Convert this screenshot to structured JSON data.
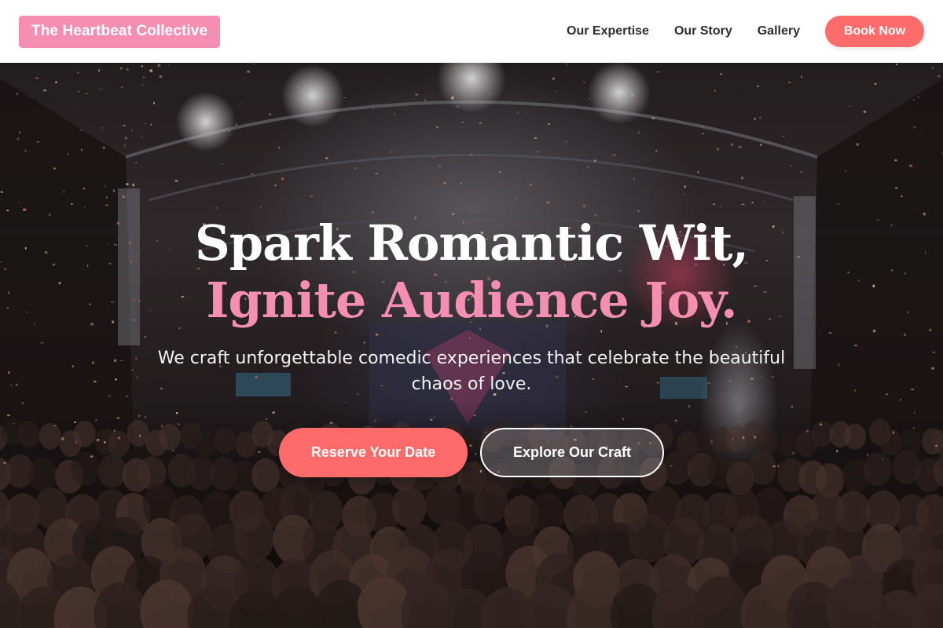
{
  "header": {
    "brand": "The Heartbeat Collective",
    "nav": [
      {
        "label": "Our Expertise"
      },
      {
        "label": "Our Story"
      },
      {
        "label": "Gallery"
      }
    ],
    "cta_label": "Book Now"
  },
  "hero": {
    "headline_line1": "Spark Romantic Wit,",
    "headline_line2": "Ignite Audience Joy.",
    "subtitle": "We craft unforgettable comedic experiences that celebrate the beautiful chaos of love.",
    "primary_button": "Reserve Your Date",
    "secondary_button": "Explore Our Craft",
    "background_image": "concert-crowd-confetti-photo"
  },
  "colors": {
    "accent_pink": "#f48fb1",
    "accent_coral": "#ff6b6b",
    "header_bg": "#ffffff",
    "nav_text": "#2d2d2d"
  }
}
